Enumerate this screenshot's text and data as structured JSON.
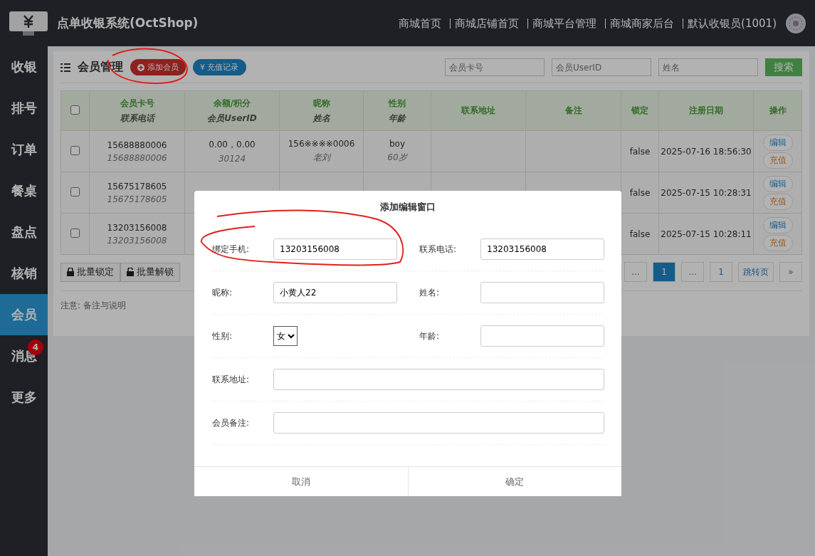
{
  "header": {
    "title": "点单收银系统(OctShop)",
    "links": [
      "商城首页",
      "商城店铺首页",
      "商城平台管理",
      "商城商家后台",
      "默认收银员(1001)"
    ]
  },
  "sidebar": {
    "items": [
      {
        "label": "收银",
        "selected": false
      },
      {
        "label": "排号",
        "selected": false
      },
      {
        "label": "订单",
        "selected": false
      },
      {
        "label": "餐桌",
        "selected": false
      },
      {
        "label": "盘点",
        "selected": false
      },
      {
        "label": "核销",
        "selected": false
      },
      {
        "label": "会员",
        "selected": true
      },
      {
        "label": "消息",
        "selected": false,
        "badge": "4"
      },
      {
        "label": "更多",
        "selected": false
      }
    ]
  },
  "toolbar": {
    "title": "会员管理",
    "add_button": "添加会员",
    "recharge_button": "¥ 充值记录",
    "search_fields": [
      {
        "placeholder": "会员卡号"
      },
      {
        "placeholder": "会员UserID"
      },
      {
        "placeholder": "姓名"
      }
    ],
    "search_button": "搜索"
  },
  "table": {
    "select_all": {
      "checked": false
    },
    "columns": [
      {
        "title": "会员卡号",
        "sub": "联系电话"
      },
      {
        "title": "余额/积分",
        "sub": "会员UserID"
      },
      {
        "title": "昵称",
        "sub": "姓名"
      },
      {
        "title": "性别",
        "sub": "年龄"
      },
      {
        "title": "联系地址"
      },
      {
        "title": "备注"
      },
      {
        "title": "锁定"
      },
      {
        "title": "注册日期"
      },
      {
        "title": "操作"
      }
    ],
    "rows": [
      {
        "checked": false,
        "cells": [
          {
            "main": "15688880006",
            "sub": "15688880006"
          },
          {
            "main": "0.00，0.00",
            "sub": "30124"
          },
          {
            "main": "156※※※※0006",
            "sub": "老刘"
          },
          {
            "main": "boy",
            "sub": "60岁"
          },
          {},
          {},
          {
            "main": "false"
          },
          {
            "main": "2025-07-16 18:56:30"
          }
        ],
        "actions": [
          "编辑",
          "充值"
        ]
      },
      {
        "checked": false,
        "cells": [
          {
            "main": "15675178605",
            "sub": "15675178605"
          },
          {},
          {},
          {},
          {},
          {},
          {
            "main": "false"
          },
          {
            "main": "2025-07-15 10:28:31"
          }
        ],
        "actions": [
          "编辑",
          "充值"
        ]
      },
      {
        "checked": false,
        "cells": [
          {
            "main": "13203156008",
            "sub": "13203156008"
          },
          {},
          {},
          {},
          {},
          {},
          {
            "main": "false"
          },
          {
            "main": "2025-07-15 10:28:11"
          }
        ],
        "actions": [
          "编辑",
          "充值"
        ]
      }
    ]
  },
  "batch_buttons": [
    "批量锁定",
    "批量解锁"
  ],
  "pagination": [
    {
      "label": "...",
      "selected": false
    },
    {
      "label": "1",
      "selected": true
    },
    {
      "label": "...",
      "selected": false
    },
    {
      "label": "1",
      "selected": false
    },
    {
      "label": "跳转页",
      "selected": false
    },
    {
      "label": "»",
      "selected": false
    }
  ],
  "note": "注意: 备注与说明",
  "dialog": {
    "title": "添加编辑窗口",
    "rows": [
      [
        {
          "label": "绑定手机:",
          "kind": "input",
          "value": "13203156008"
        },
        {
          "label": "联系电话:",
          "kind": "input",
          "value": "13203156008"
        }
      ],
      [
        {
          "label": "昵称:",
          "kind": "input",
          "value": "小黄人22"
        },
        {
          "label": "姓名:",
          "kind": "input"
        }
      ],
      [
        {
          "label": "性别:",
          "kind": "select",
          "value": "女"
        },
        {
          "label": "年龄:",
          "kind": "input"
        }
      ],
      [
        {
          "label": "联系地址:",
          "kind": "input"
        }
      ],
      [
        {
          "label": "会员备注:",
          "kind": "input"
        }
      ]
    ],
    "buttons": [
      "取消",
      "确定"
    ]
  }
}
